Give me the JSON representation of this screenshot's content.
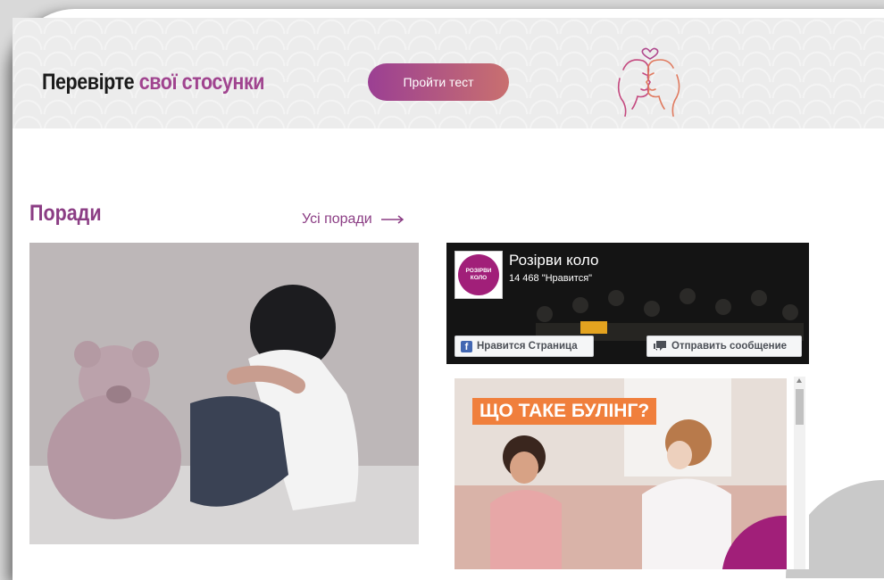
{
  "banner": {
    "title_plain": "Перевірте ",
    "title_accent": "свої стосунки",
    "cta_label": "Пройти тест",
    "illustration": "couple-illustration-icon"
  },
  "tips": {
    "title": "Поради",
    "all_link": "Усі поради"
  },
  "facebook": {
    "page_name": "Розірви коло",
    "likes": "14 468 \"Нравится\"",
    "logo_line1": "РОЗІРВИ",
    "logo_line2": "КОЛО",
    "like_button": "Нравится Страница",
    "message_button": "Отправить сообщение",
    "post_badge": "ЩО ТАКЕ БУЛІНГ?"
  },
  "colors": {
    "accent": "#8b3d84",
    "cta_start": "#9b3f93",
    "cta_end": "#c9706f",
    "fb_blue": "#4267b2",
    "badge": "#f07f3c"
  }
}
